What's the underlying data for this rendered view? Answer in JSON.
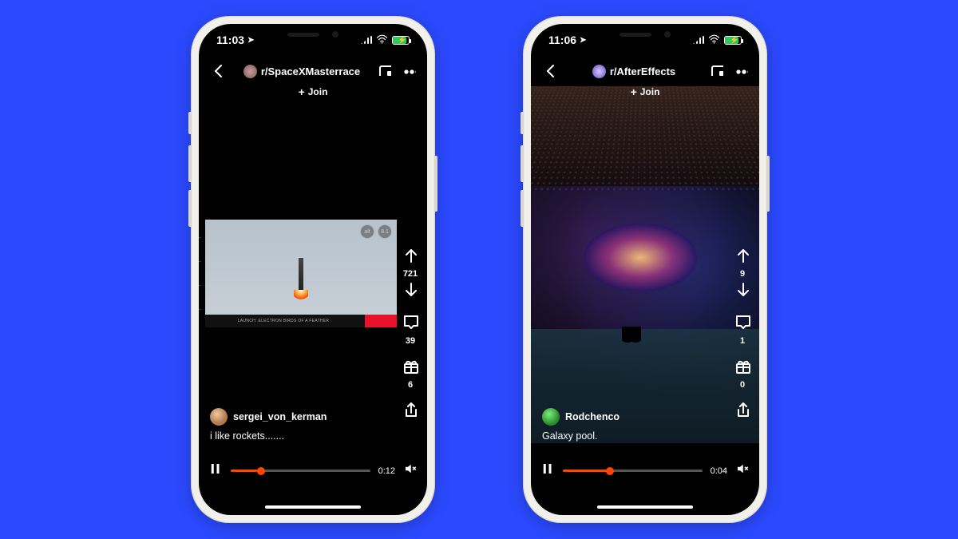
{
  "phones": [
    {
      "status": {
        "time": "11:03",
        "location_icon": "➤"
      },
      "header": {
        "subreddit": "r/SpaceXMasterrace",
        "sub_icon_color": "#7a5c44",
        "join_label": "Join"
      },
      "votes": {
        "up_count": "721"
      },
      "comments_count": "39",
      "awards_count": "6",
      "author": {
        "name": "sergei_von_kerman",
        "avatar_color1": "#d9a47a",
        "avatar_color2": "#8a5a3a"
      },
      "caption": "i like rockets.......",
      "playback": {
        "time": "0:12",
        "progress_pct": 22
      },
      "video_overlay": {
        "banner_text": "LAUNCH: ELECTRON BIRDS OF A FEATHER"
      }
    },
    {
      "status": {
        "time": "11:06",
        "location_icon": "➤"
      },
      "header": {
        "subreddit": "r/AfterEffects",
        "sub_icon_color": "#6b4bc4",
        "join_label": "Join"
      },
      "votes": {
        "up_count": "9"
      },
      "comments_count": "1",
      "awards_count": "0",
      "author": {
        "name": "Rodchenco",
        "avatar_color1": "#4bd84b",
        "avatar_color2": "#2a8a2a"
      },
      "caption": "Galaxy pool.",
      "playback": {
        "time": "0:04",
        "progress_pct": 34
      }
    }
  ]
}
